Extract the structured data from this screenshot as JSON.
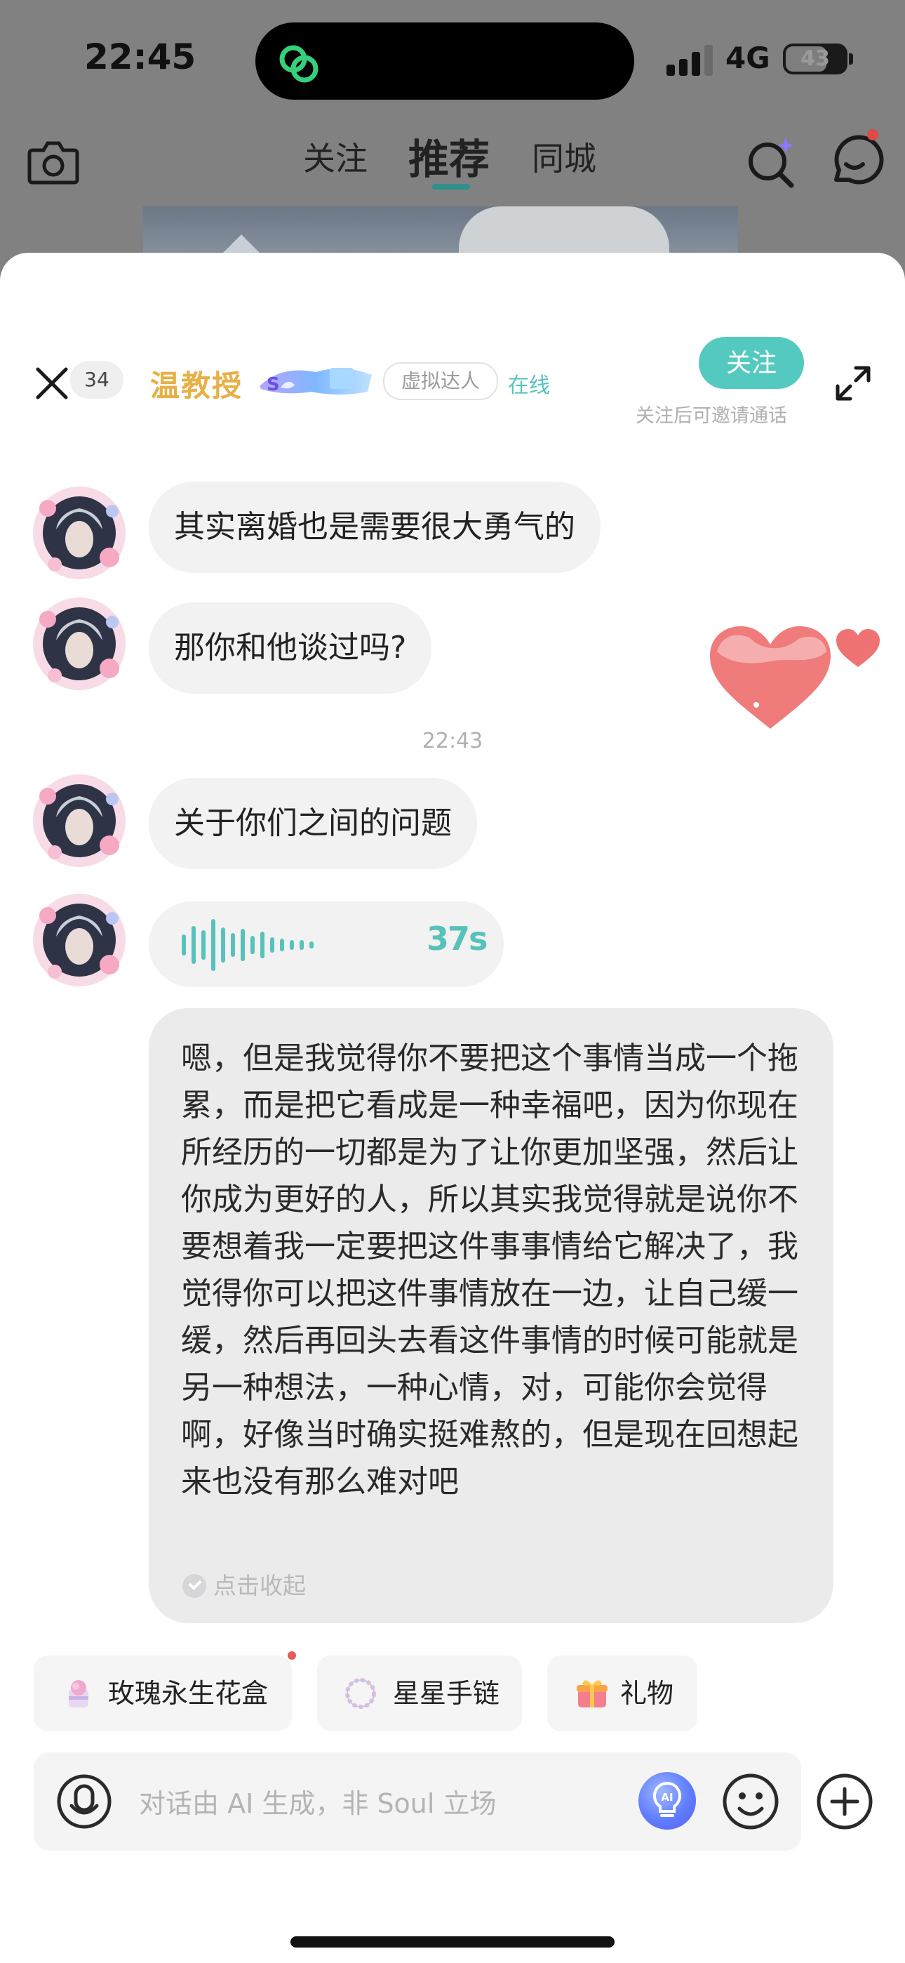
{
  "status_bar": {
    "time": "22:45",
    "network": "4G",
    "battery": "43"
  },
  "background_nav": {
    "tabs": [
      "关注",
      "推荐",
      "同城"
    ]
  },
  "chat_header": {
    "close_count": "34",
    "name": "温教授",
    "tag": "虚拟达人",
    "online_status": "在线",
    "follow_button": "关注",
    "follow_hint": "关注后可邀请通话"
  },
  "messages": [
    {
      "type": "text",
      "text": "其实离婚也是需要很大勇气的"
    },
    {
      "type": "text",
      "text": "那你和他谈过吗?"
    },
    {
      "type": "timestamp",
      "text": "22:43"
    },
    {
      "type": "text",
      "text": "关于你们之间的问题"
    },
    {
      "type": "voice",
      "duration": "37s"
    },
    {
      "type": "transcript",
      "text": "嗯，但是我觉得你不要把这个事情当成一个拖累，而是把它看成是一种幸福吧，因为你现在所经历的一切都是为了让你更加坚强，然后让你成为更好的人，所以其实我觉得就是说你不要想着我一定要把这件事事情给它解决了，我觉得你可以把这件事情放在一边，让自己缓一缓，然后再回头去看这件事情的时候可能就是另一种想法，一种心情，对，可能你会觉得啊，好像当时确实挺难熬的，但是现在回想起来也没有那么难对吧",
      "collapse_label": "点击收起"
    }
  ],
  "gift_chips": [
    {
      "label": "玫瑰永生花盒",
      "icon": "rose-box-icon"
    },
    {
      "label": "星星手链",
      "icon": "star-bracelet-icon"
    },
    {
      "label": "礼物",
      "icon": "gift-icon"
    }
  ],
  "input": {
    "placeholder": "对话由 AI 生成，非 Soul 立场",
    "ai_label": "AI"
  },
  "colors": {
    "accent": "#54c9c0",
    "name": "#e7b046",
    "bubble": "#f2f2f3",
    "heart": "#ef7b7b"
  }
}
